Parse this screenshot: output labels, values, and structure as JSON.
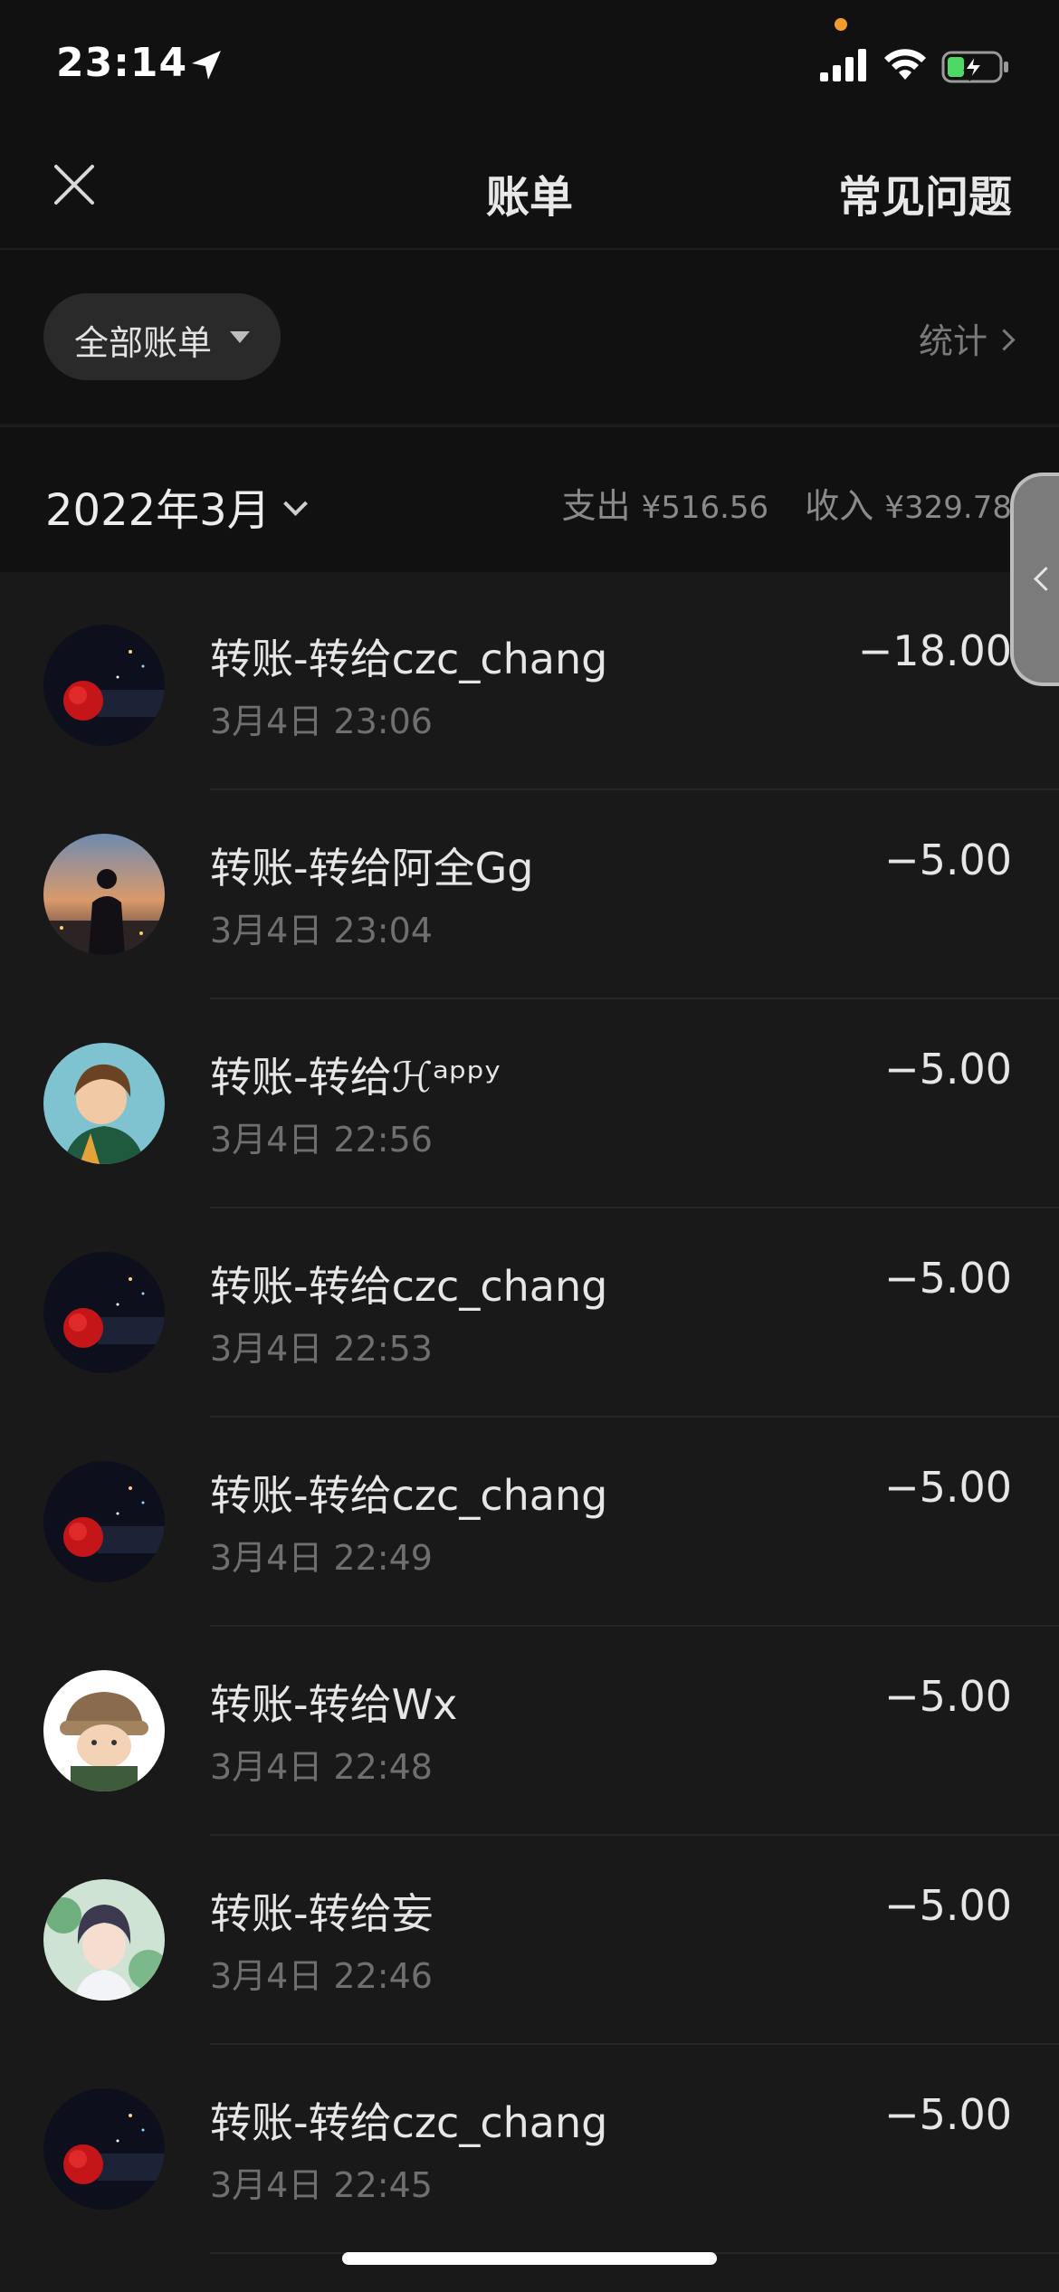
{
  "status_bar": {
    "time": "23:14",
    "icons": [
      "location-arrow-icon",
      "signal-icon",
      "wifi-icon",
      "battery-charging-icon"
    ],
    "colors": {
      "privacy_dot": "#f29a2e",
      "battery_fill": "#4cd964"
    }
  },
  "nav": {
    "close_icon": "close-icon",
    "title": "账单",
    "faq": "常见问题"
  },
  "filter": {
    "label": "全部账单",
    "stats": "统计"
  },
  "month": {
    "label": "2022年3月",
    "expense_label": "支出",
    "expense_amount": "¥516.56",
    "income_label": "收入",
    "income_amount": "¥329.78"
  },
  "transactions": [
    {
      "title": "转账-转给czc_chang",
      "time": "3月4日 23:06",
      "amount": "−18.00",
      "avatar": "avatar-night-rose"
    },
    {
      "title": "转账-转给阿全Gg",
      "time": "3月4日 23:04",
      "amount": "−5.00",
      "avatar": "avatar-sunset-silhouette"
    },
    {
      "title": "转账-转给ℋᵃᵖᵖʸ",
      "time": "3月4日 22:56",
      "amount": "−5.00",
      "avatar": "avatar-anime-boy"
    },
    {
      "title": "转账-转给czc_chang",
      "time": "3月4日 22:53",
      "amount": "−5.00",
      "avatar": "avatar-night-rose"
    },
    {
      "title": "转账-转给czc_chang",
      "time": "3月4日 22:49",
      "amount": "−5.00",
      "avatar": "avatar-night-rose"
    },
    {
      "title": "转账-转给Wx",
      "time": "3月4日 22:48",
      "amount": "−5.00",
      "avatar": "avatar-hat-character"
    },
    {
      "title": "转账-转给妄",
      "time": "3月4日 22:46",
      "amount": "−5.00",
      "avatar": "avatar-anime-portrait"
    },
    {
      "title": "转账-转给czc_chang",
      "time": "3月4日 22:45",
      "amount": "−5.00",
      "avatar": "avatar-night-rose"
    }
  ]
}
